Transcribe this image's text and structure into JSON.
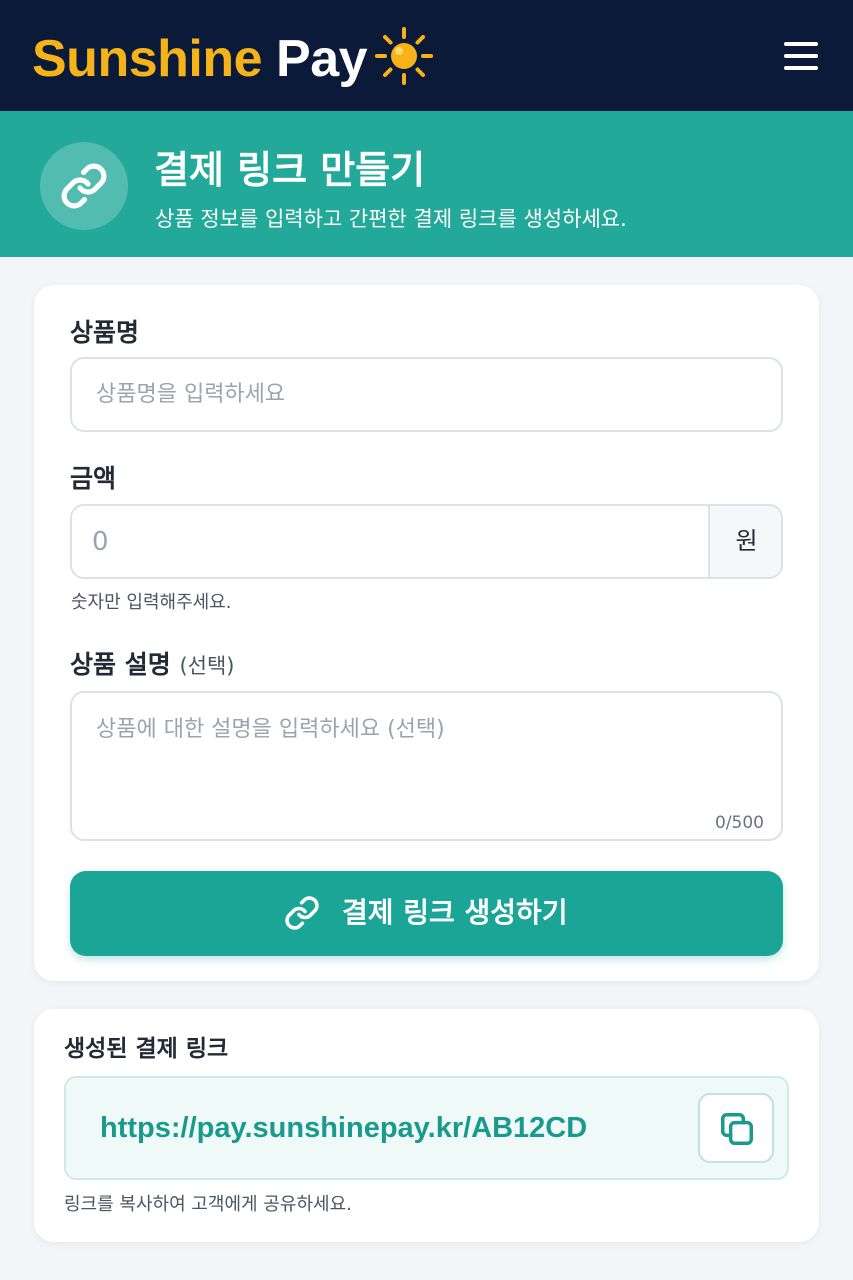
{
  "header": {
    "brand_part1": "Sunshine",
    "brand_part2": "Pay",
    "sun_icon": "sun-icon",
    "menu_icon": "hamburger-menu-icon"
  },
  "hero": {
    "icon": "link-icon",
    "title": "결제 링크 만들기",
    "subtitle": "상품 정보를 입력하고 간편한 결제 링크를 생성하세요."
  },
  "form": {
    "product_name_label": "상품명",
    "product_name_placeholder": "상품명을 입력하세요",
    "amount_label": "금액",
    "amount_placeholder": "0",
    "amount_unit": "원",
    "amount_hint": "숫자만 입력해주세요.",
    "description_label": "상품 설명",
    "description_optional": "(선택)",
    "description_placeholder": "상품에 대한 설명을 입력하세요 (선택)",
    "char_counter": "0/500",
    "submit_label": "결제 링크 생성하기",
    "submit_icon": "link-icon"
  },
  "result": {
    "title": "생성된 결제 링크",
    "link": "https://pay.sunshinepay.kr/AB12CD",
    "copy_icon": "copy-icon",
    "hint": "링크를 복사하여 고객에게 공유하세요."
  },
  "colors": {
    "navy": "#0c1a3a",
    "brand_yellow": "#f5b319",
    "teal": "#22a99a",
    "button_teal": "#1aa597",
    "link_teal": "#1a9a8c"
  }
}
